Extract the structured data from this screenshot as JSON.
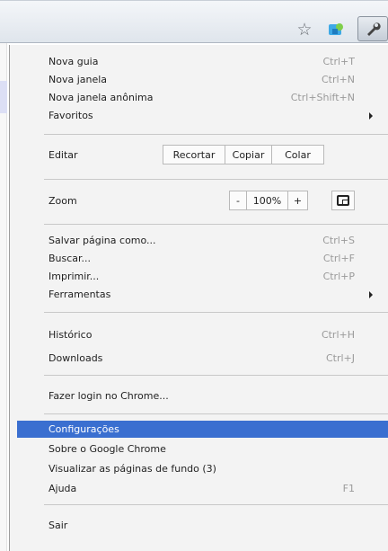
{
  "menu": {
    "group1": [
      {
        "label": "Nova guia",
        "shortcut": "Ctrl+T"
      },
      {
        "label": "Nova janela",
        "shortcut": "Ctrl+N"
      },
      {
        "label": "Nova janela anônima",
        "shortcut": "Ctrl+Shift+N"
      },
      {
        "label": "Favoritos",
        "shortcut": ""
      }
    ],
    "edit": {
      "label": "Editar",
      "cut": "Recortar",
      "copy": "Copiar",
      "paste": "Colar"
    },
    "zoom": {
      "label": "Zoom",
      "minus": "-",
      "value": "100%",
      "plus": "+"
    },
    "group2": [
      {
        "label": "Salvar página como...",
        "shortcut": "Ctrl+S"
      },
      {
        "label": "Buscar...",
        "shortcut": "Ctrl+F"
      },
      {
        "label": "Imprimir...",
        "shortcut": "Ctrl+P"
      },
      {
        "label": "Ferramentas",
        "shortcut": ""
      }
    ],
    "group3": [
      {
        "label": "Histórico",
        "shortcut": "Ctrl+H"
      },
      {
        "label": "Downloads",
        "shortcut": "Ctrl+J"
      }
    ],
    "login": "Fazer login no Chrome...",
    "group4": [
      {
        "label": "Configurações",
        "shortcut": ""
      },
      {
        "label": "Sobre o Google Chrome",
        "shortcut": ""
      },
      {
        "label": "Visualizar as páginas de fundo (3)",
        "shortcut": ""
      },
      {
        "label": "Ajuda",
        "shortcut": "F1"
      }
    ],
    "exit": "Sair"
  },
  "toolbar": {
    "icons": [
      "star-icon",
      "extension-icon",
      "wrench-icon"
    ]
  },
  "colors": {
    "highlight": "#3a6fd0"
  }
}
